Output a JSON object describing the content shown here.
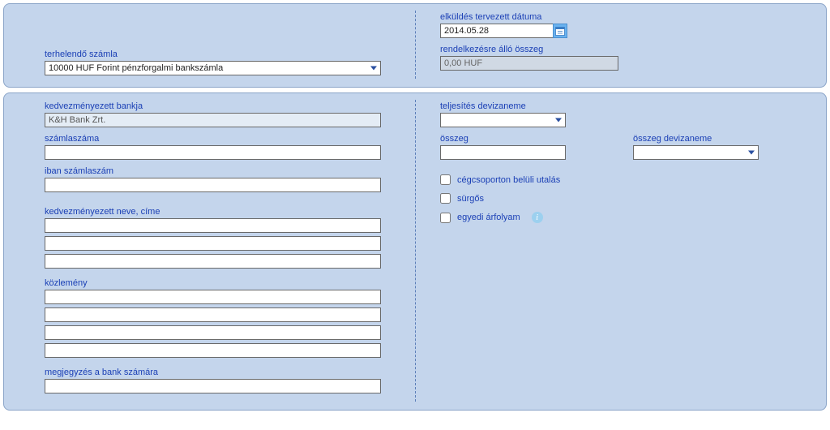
{
  "top": {
    "debit_account_label": "terhelendő számla",
    "debit_account_value": "10000 HUF Forint pénzforgalmi bankszámla",
    "planned_date_label": "elküldés tervezett dátuma",
    "planned_date_value": "2014.05.28",
    "available_label": "rendelkezésre álló összeg",
    "available_value": "0,00 HUF"
  },
  "left": {
    "beneficiary_bank_label": "kedvezményezett bankja",
    "beneficiary_bank_value": "K&H Bank Zrt.",
    "account_number_label": "számlaszáma",
    "account_number_value": "",
    "iban_label": "iban számlaszám",
    "iban_value": "",
    "beneficiary_name_label": "kedvezményezett neve, címe",
    "beneficiary_name_lines": [
      "",
      "",
      ""
    ],
    "remittance_label": "közlemény",
    "remittance_lines": [
      "",
      "",
      "",
      ""
    ],
    "bank_note_label": "megjegyzés a bank számára",
    "bank_note_value": ""
  },
  "right": {
    "performance_currency_label": "teljesítés devizaneme",
    "performance_currency_value": "",
    "amount_label": "összeg",
    "amount_value": "",
    "amount_currency_label": "összeg devizaneme",
    "amount_currency_value": "",
    "intragroup_label": "cégcsoporton belüli utalás",
    "urgent_label": "sürgős",
    "custom_rate_label": "egyedi árfolyam"
  }
}
